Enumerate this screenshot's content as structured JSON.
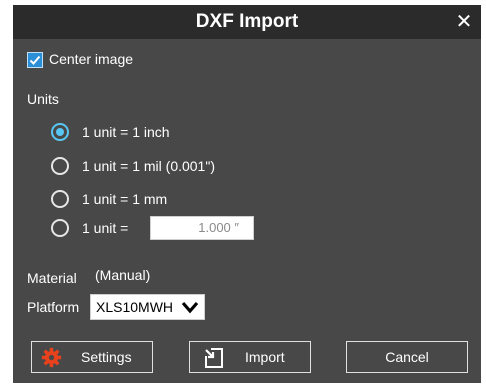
{
  "dialog": {
    "title": "DXF Import",
    "close_label": "✕"
  },
  "center_image": {
    "label": "Center image",
    "checked": true
  },
  "units": {
    "heading": "Units",
    "options": [
      {
        "label": "1 unit = 1 inch",
        "selected": true
      },
      {
        "label": "1 unit = 1 mil (0.001\")",
        "selected": false
      },
      {
        "label": "1 unit = 1 mm",
        "selected": false
      },
      {
        "label": "1 unit =",
        "selected": false
      }
    ],
    "custom_value": "1.000  ″"
  },
  "material": {
    "label": "Material",
    "value": "(Manual)"
  },
  "platform": {
    "label": "Platform",
    "selected": "XLS10MWH"
  },
  "buttons": {
    "settings": "Settings",
    "import": "Import",
    "cancel": "Cancel"
  },
  "colors": {
    "dialog_bg": "#484848",
    "title_bg": "#2b2b2b",
    "accent": "#58c7f2",
    "settings_icon": "#e8421c"
  }
}
